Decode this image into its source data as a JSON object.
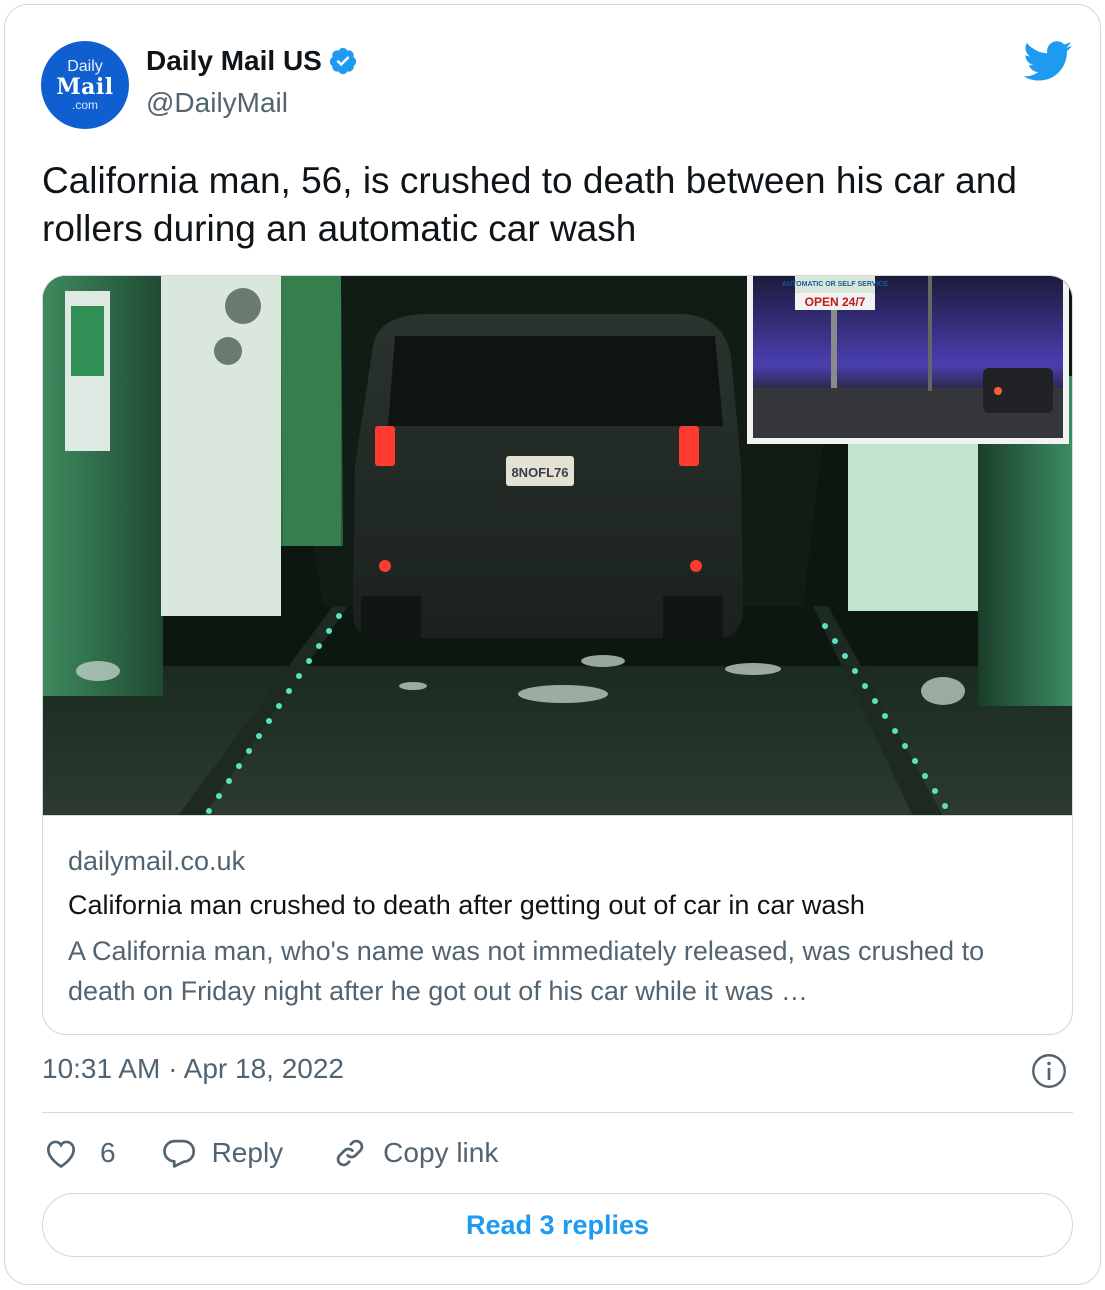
{
  "author": {
    "name": "Daily Mail US",
    "handle": "@DailyMail",
    "avatar_lines": [
      "Daily",
      "Mail",
      ".com"
    ]
  },
  "tweet": {
    "text": "California man, 56, is crushed to death between his car and rollers during an automatic car wash"
  },
  "photo": {
    "license_plate": "8NOFL76",
    "inset_sign_top": "AUTOMATIC OR SELF SERVICE",
    "inset_sign_open": "OPEN 24/7"
  },
  "card": {
    "domain": "dailymail.co.uk",
    "title": "California man crushed to death after getting out of car in car wash",
    "description": "A California man, who's name was not immediately released, was crushed to death on Friday night after he got out of his car while it was …"
  },
  "timestamp": "10:31 AM · Apr 18, 2022",
  "actions": {
    "like_count": "6",
    "reply_label": "Reply",
    "copy_label": "Copy link"
  },
  "read_replies_label": "Read 3 replies",
  "colors": {
    "accent": "#1d9bf0",
    "secondary_text": "#536471",
    "border": "#cfd9de",
    "avatar_bg": "#0f5fd1"
  }
}
